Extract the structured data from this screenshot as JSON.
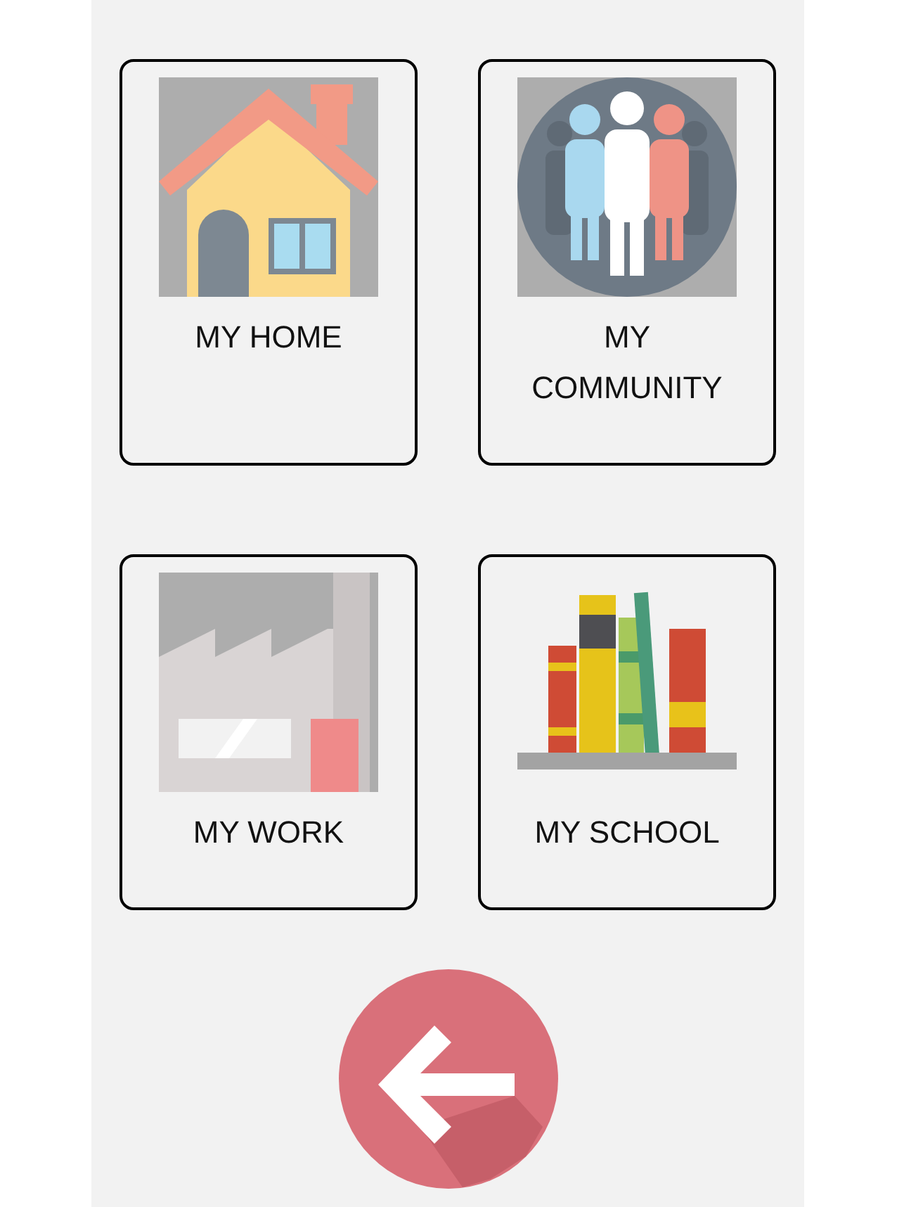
{
  "cards": [
    {
      "label": "MY HOME",
      "kind": "home"
    },
    {
      "label": "MY COMMUNITY",
      "kind": "community"
    },
    {
      "label": "MY WORK",
      "kind": "work"
    },
    {
      "label": "MY SCHOOL",
      "kind": "school"
    }
  ]
}
